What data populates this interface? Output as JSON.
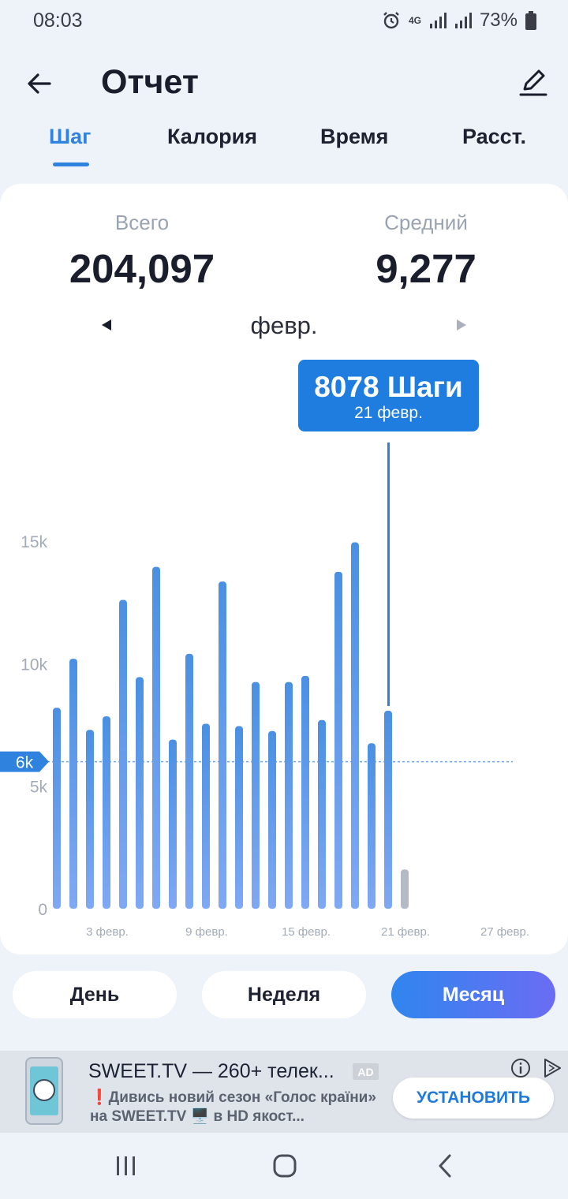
{
  "status_bar": {
    "time": "08:03",
    "network": "4G",
    "battery": "73%"
  },
  "header": {
    "title": "Отчет"
  },
  "tabs": [
    {
      "label": "Шаг",
      "active": true
    },
    {
      "label": "Калория",
      "active": false
    },
    {
      "label": "Время",
      "active": false
    },
    {
      "label": "Расст.",
      "active": false
    }
  ],
  "summary": {
    "total_label": "Всего",
    "total_value": "204,097",
    "average_label": "Средний",
    "average_value": "9,277"
  },
  "month_label": "февр.",
  "tooltip": {
    "value": "8078 Шаги",
    "date": "21 февр."
  },
  "chart_data": {
    "type": "bar",
    "y_ticks": [
      "0",
      "5k",
      "10k",
      "15k"
    ],
    "ylim": [
      0,
      15000
    ],
    "goal_label": "6k",
    "goal_value": 6000,
    "x_tick_labels": [
      "3 февр.",
      "9 февр.",
      "15 февр.",
      "21 февр.",
      "27 февр."
    ],
    "x_tick_days": [
      3,
      9,
      15,
      21,
      27
    ],
    "days": [
      1,
      2,
      3,
      4,
      5,
      6,
      7,
      8,
      9,
      10,
      11,
      12,
      13,
      14,
      15,
      16,
      17,
      18,
      19,
      20,
      21,
      22
    ],
    "values": [
      8200,
      10200,
      7300,
      7850,
      12600,
      9450,
      13950,
      6900,
      10400,
      7550,
      13350,
      7450,
      9250,
      7250,
      9250,
      9500,
      7700,
      13750,
      14950,
      6750,
      8078,
      1600
    ],
    "selected_day": 21,
    "current_day": 22,
    "colors": {
      "bar": "#4f93e2",
      "current": "#b4bac6",
      "goal_line": "#7aa6df",
      "goal_badge": "#2f83df"
    }
  },
  "periods": [
    {
      "label": "День",
      "active": false
    },
    {
      "label": "Неделя",
      "active": false
    },
    {
      "label": "Месяц",
      "active": true
    }
  ],
  "ad": {
    "title": "SWEET.TV — 260+ телек...",
    "badge": "AD",
    "description": "❗Дивись новий сезон «Голос країни» на SWEET.TV 🖥️ в HD якост...",
    "install_label": "УСТАНОВИТЬ"
  }
}
